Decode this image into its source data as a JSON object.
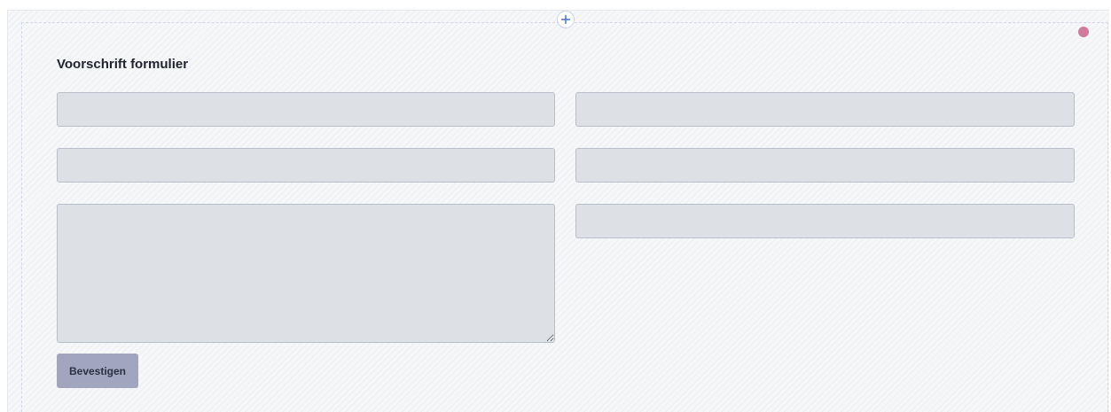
{
  "form": {
    "title": "Voorschrift formulier",
    "fields": [
      {
        "value": "",
        "placeholder": ""
      },
      {
        "value": "",
        "placeholder": ""
      },
      {
        "value": "",
        "placeholder": ""
      },
      {
        "value": "",
        "placeholder": ""
      },
      {
        "value": "",
        "placeholder": ""
      }
    ],
    "message": {
      "value": "",
      "placeholder": ""
    },
    "submit_label": "Bevestigen"
  },
  "icons": {
    "add_section": "plus-icon",
    "status": "status-dot"
  },
  "colors": {
    "field_bg": "#dde1e6",
    "field_border": "#b9bfca",
    "button_bg": "#a1a5be",
    "status_dot": "#d27a9b",
    "accent_plus": "#3d73c7"
  }
}
